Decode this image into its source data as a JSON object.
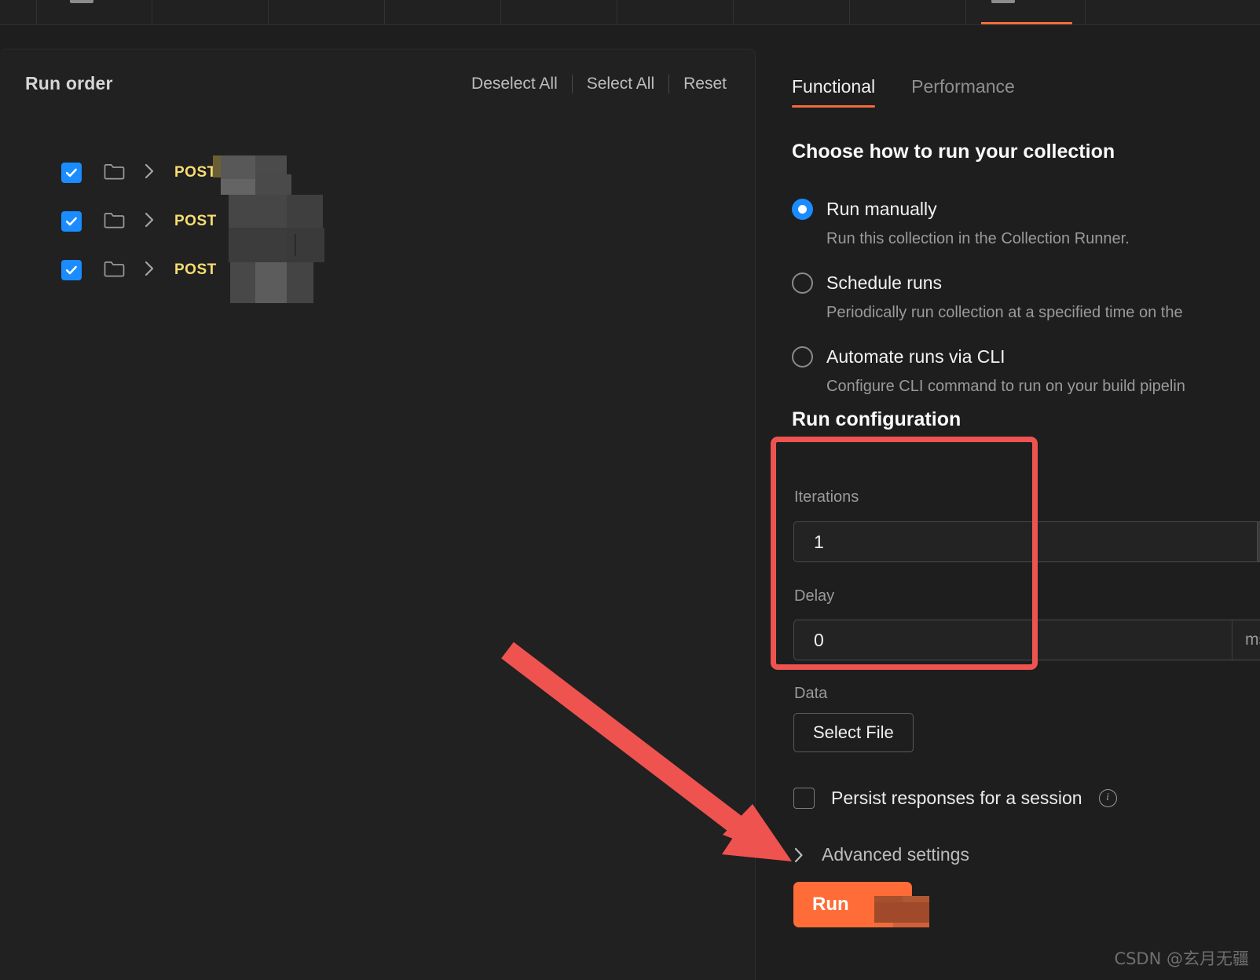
{
  "window": {
    "background": "#1e1e1e",
    "panel_background": "#212121",
    "accent_orange": "#ff6c37",
    "accent_blue": "#1a8cff",
    "annotation_red": "#ef5350",
    "method_yellow": "#f7dd72"
  },
  "left_panel": {
    "title": "Run order",
    "actions": [
      {
        "label": "Deselect All",
        "name": "deselect-all-button"
      },
      {
        "label": "Select All",
        "name": "select-all-button"
      },
      {
        "label": "Reset",
        "name": "reset-button"
      }
    ],
    "rows": [
      {
        "checked": true,
        "method": "POST",
        "name_redacted": true
      },
      {
        "checked": true,
        "method": "POST",
        "name_redacted": true
      },
      {
        "checked": true,
        "method": "POST",
        "name_redacted": true
      }
    ]
  },
  "right_panel": {
    "tabs": [
      {
        "label": "Functional",
        "active": true
      },
      {
        "label": "Performance",
        "active": false
      }
    ],
    "choose_section": {
      "title": "Choose how to run your collection",
      "options": [
        {
          "label": "Run manually",
          "description": "Run this collection in the Collection Runner.",
          "selected": true
        },
        {
          "label": "Schedule runs",
          "description": "Periodically run collection at a specified time on the",
          "selected": false
        },
        {
          "label": "Automate runs via CLI",
          "description": "Configure CLI command to run on your build pipelin",
          "selected": false
        }
      ]
    },
    "run_configuration": {
      "title": "Run configuration",
      "iterations": {
        "label": "Iterations",
        "value": "1"
      },
      "delay": {
        "label": "Delay",
        "value": "0",
        "unit": "ms"
      },
      "data": {
        "label": "Data",
        "select_file_label": "Select File"
      },
      "persist": {
        "label": "Persist responses for a session",
        "checked": false,
        "info": "i"
      },
      "advanced": {
        "label": "Advanced settings",
        "expanded": false
      },
      "run_button": {
        "label": "Run",
        "name_redacted": true
      }
    }
  },
  "watermark": {
    "text": "CSDN @玄月无疆"
  }
}
